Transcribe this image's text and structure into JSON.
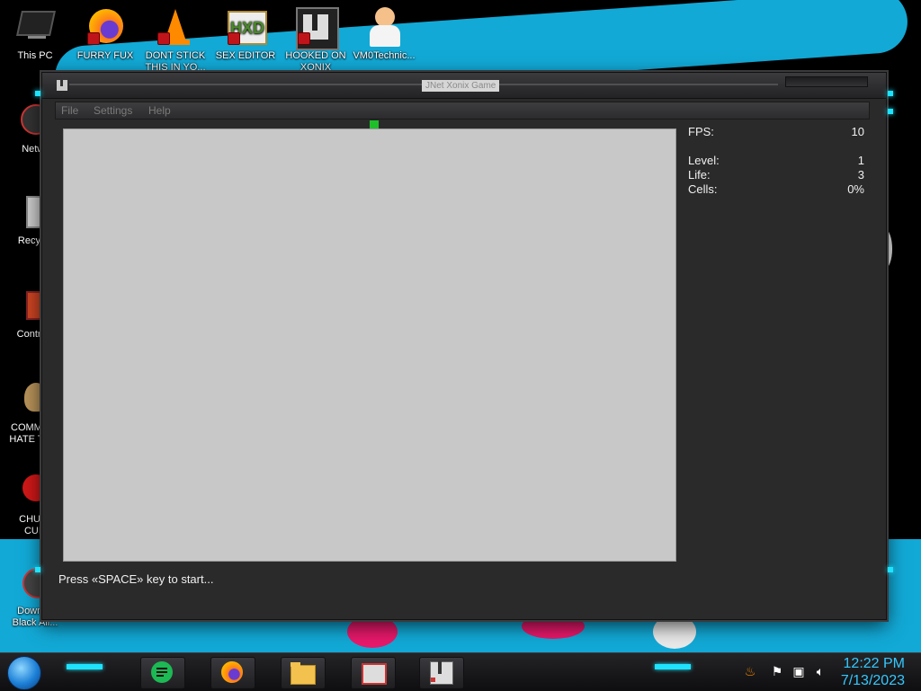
{
  "desktop": {
    "icons_top": [
      {
        "label": "This PC"
      },
      {
        "label": "FURRY FUX"
      },
      {
        "label": "DONT STICK THIS IN YO..."
      },
      {
        "label": "SEX EDITOR"
      },
      {
        "label": "HOOKED ON XONIX"
      },
      {
        "label": "VM0Technic..."
      }
    ],
    "icons_left": [
      {
        "label": "Netw..."
      },
      {
        "label": "Recycl..."
      },
      {
        "label": "Control..."
      },
      {
        "label": "COMMU... HATE TH..."
      },
      {
        "label": "CHUZ... CUI..."
      },
      {
        "label": "Downl... Black Ali..."
      }
    ]
  },
  "window": {
    "title": "JNet Xonix Game",
    "menu": [
      "File",
      "Settings",
      "Help"
    ],
    "stats": [
      {
        "key": "FPS:",
        "value": "10"
      },
      {
        "key": "Level:",
        "value": "1"
      },
      {
        "key": "Life:",
        "value": "3"
      },
      {
        "key": "Cells:",
        "value": "0%"
      }
    ],
    "status": "Press «SPACE» key to start..."
  },
  "taskbar": {
    "clock": {
      "time": "12:22 PM",
      "date": "7/13/2023"
    }
  },
  "colors": {
    "field": "#c8c8c8",
    "player": "#1fbf2a",
    "accent": "#1ee3ff",
    "clock": "#35c8ff"
  }
}
